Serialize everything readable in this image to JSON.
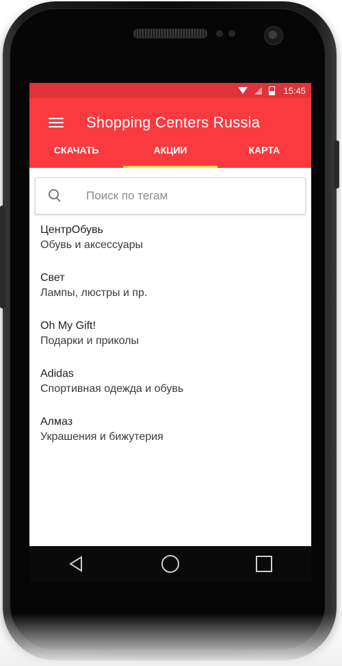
{
  "status_bar": {
    "time": "15:45",
    "color": "#e0323a"
  },
  "app_bar": {
    "title": "Shopping Centers Russia",
    "color": "#fb3a3f",
    "menu_icon": "hamburger-menu-icon"
  },
  "tabs": [
    {
      "label": "СКАЧАТЬ",
      "active": false
    },
    {
      "label": "АКЦИИ",
      "active": true
    },
    {
      "label": "КАРТА",
      "active": false
    }
  ],
  "tab_indicator_color": "#ffe63b",
  "search": {
    "placeholder": "Поиск по тегам",
    "value": "",
    "icon": "search-icon"
  },
  "stores": [
    {
      "name": "ЦентрОбувь",
      "description": "Обувь и аксессуары"
    },
    {
      "name": "Свет",
      "description": "Лампы, люстры и пр."
    },
    {
      "name": "Oh My Gift!",
      "description": "Подарки и приколы"
    },
    {
      "name": "Adidas",
      "description": "Спортивная одежда и обувь"
    },
    {
      "name": "Алмаз",
      "description": "Украшения и бижутерия"
    }
  ],
  "nav_bar": {
    "buttons": [
      "back-icon",
      "home-icon",
      "recents-icon"
    ]
  }
}
